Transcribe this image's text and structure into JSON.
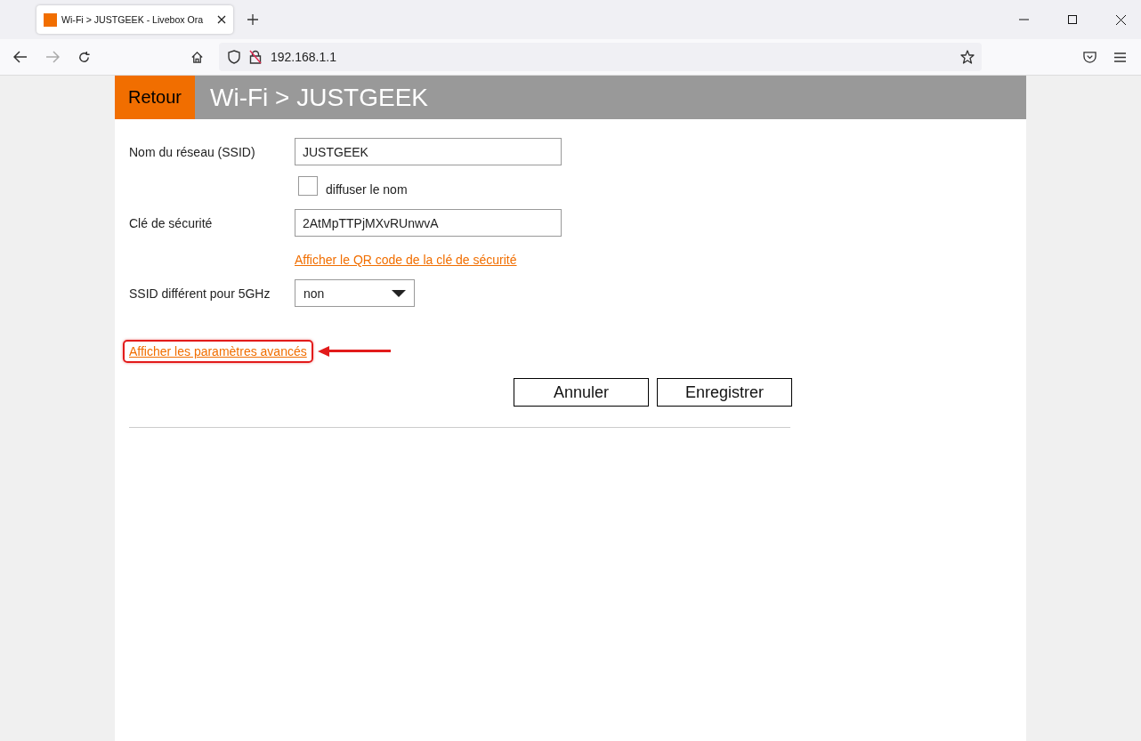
{
  "browser": {
    "tab_title": "Wi-Fi > JUSTGEEK - Livebox Ora",
    "url": "192.168.1.1"
  },
  "header": {
    "back_button": "Retour",
    "title": "Wi-Fi > JUSTGEEK"
  },
  "form": [
    {
      "kind": "text",
      "label": "Nom du réseau (SSID)",
      "value": "JUSTGEEK"
    },
    {
      "kind": "checkbox",
      "label": "diffuser le nom",
      "checked": false
    },
    {
      "kind": "text",
      "label": "Clé de sécurité",
      "value": "2AtMpTTPjMXvRUnwvA"
    },
    {
      "kind": "link",
      "label": "Afficher le QR code de la clé de sécurité"
    },
    {
      "kind": "select",
      "label": "SSID différent pour 5GHz",
      "value": "non"
    }
  ],
  "advanced_link": "Afficher les paramètres avancés",
  "buttons": [
    "Annuler",
    "Enregistrer"
  ]
}
